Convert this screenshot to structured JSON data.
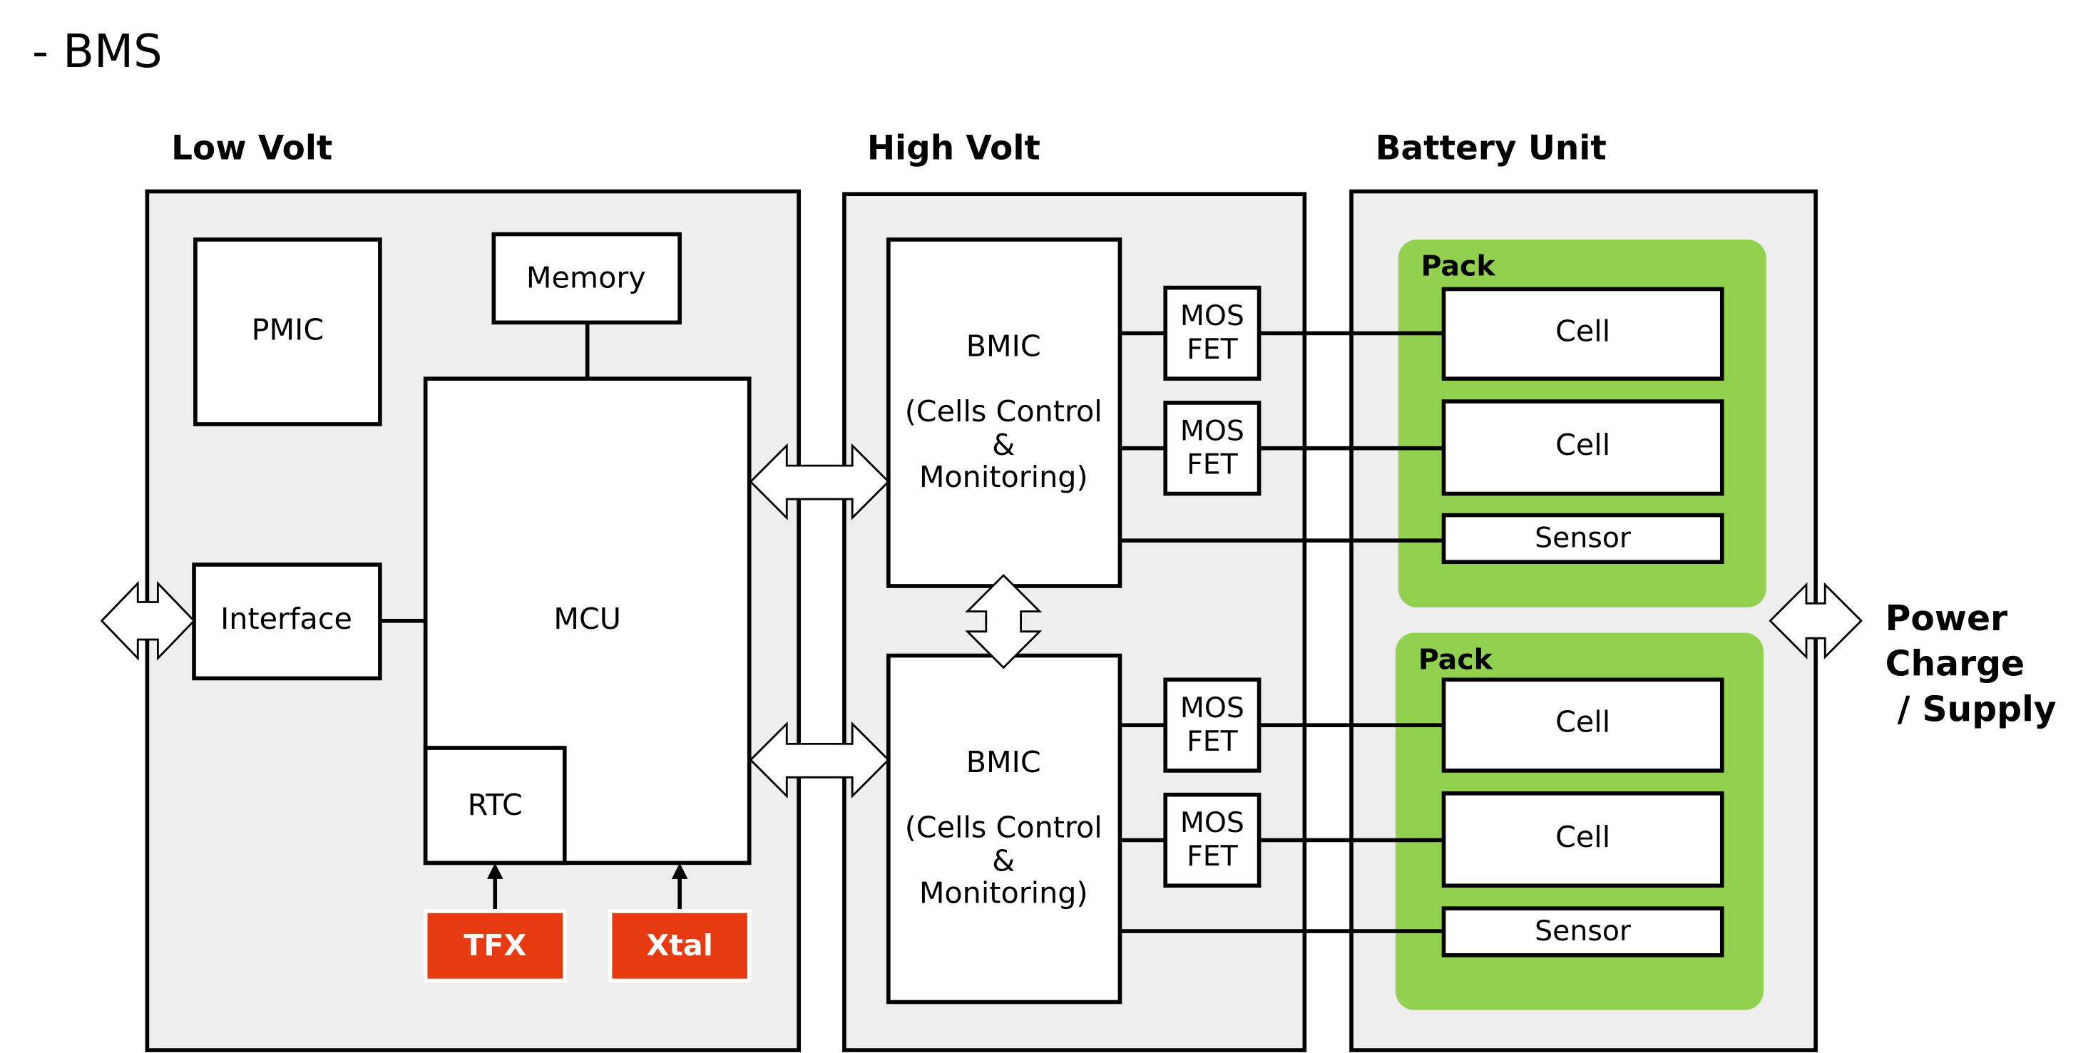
{
  "title": "- BMS",
  "sections": {
    "low_volt": {
      "heading": "Low Volt",
      "pmic": "PMIC",
      "memory": "Memory",
      "interface": "Interface",
      "mcu": "MCU",
      "rtc": "RTC",
      "tfx": "TFX",
      "xtal": "Xtal"
    },
    "high_volt": {
      "heading": "High Volt",
      "bmic_top": {
        "title": "BMIC",
        "line1": "(Cells Control",
        "line2": "&",
        "line3": "Monitoring)"
      },
      "bmic_bottom": {
        "title": "BMIC",
        "line1": "(Cells Control",
        "line2": "&",
        "line3": "Monitoring)"
      },
      "mosfets": [
        {
          "line1": "MOS",
          "line2": "FET"
        },
        {
          "line1": "MOS",
          "line2": "FET"
        },
        {
          "line1": "MOS",
          "line2": "FET"
        },
        {
          "line1": "MOS",
          "line2": "FET"
        }
      ]
    },
    "battery_unit": {
      "heading": "Battery Unit",
      "packs": [
        {
          "label": "Pack",
          "cells": [
            "Cell",
            "Cell"
          ],
          "sensor": "Sensor"
        },
        {
          "label": "Pack",
          "cells": [
            "Cell",
            "Cell"
          ],
          "sensor": "Sensor"
        }
      ]
    }
  },
  "external": {
    "power_line1": "Power",
    "power_line2": "Charge",
    "power_line3": " / Supply"
  },
  "colors": {
    "panel": "#eeeeee",
    "pack": "#92d050",
    "clock_source": "#e53a12"
  }
}
